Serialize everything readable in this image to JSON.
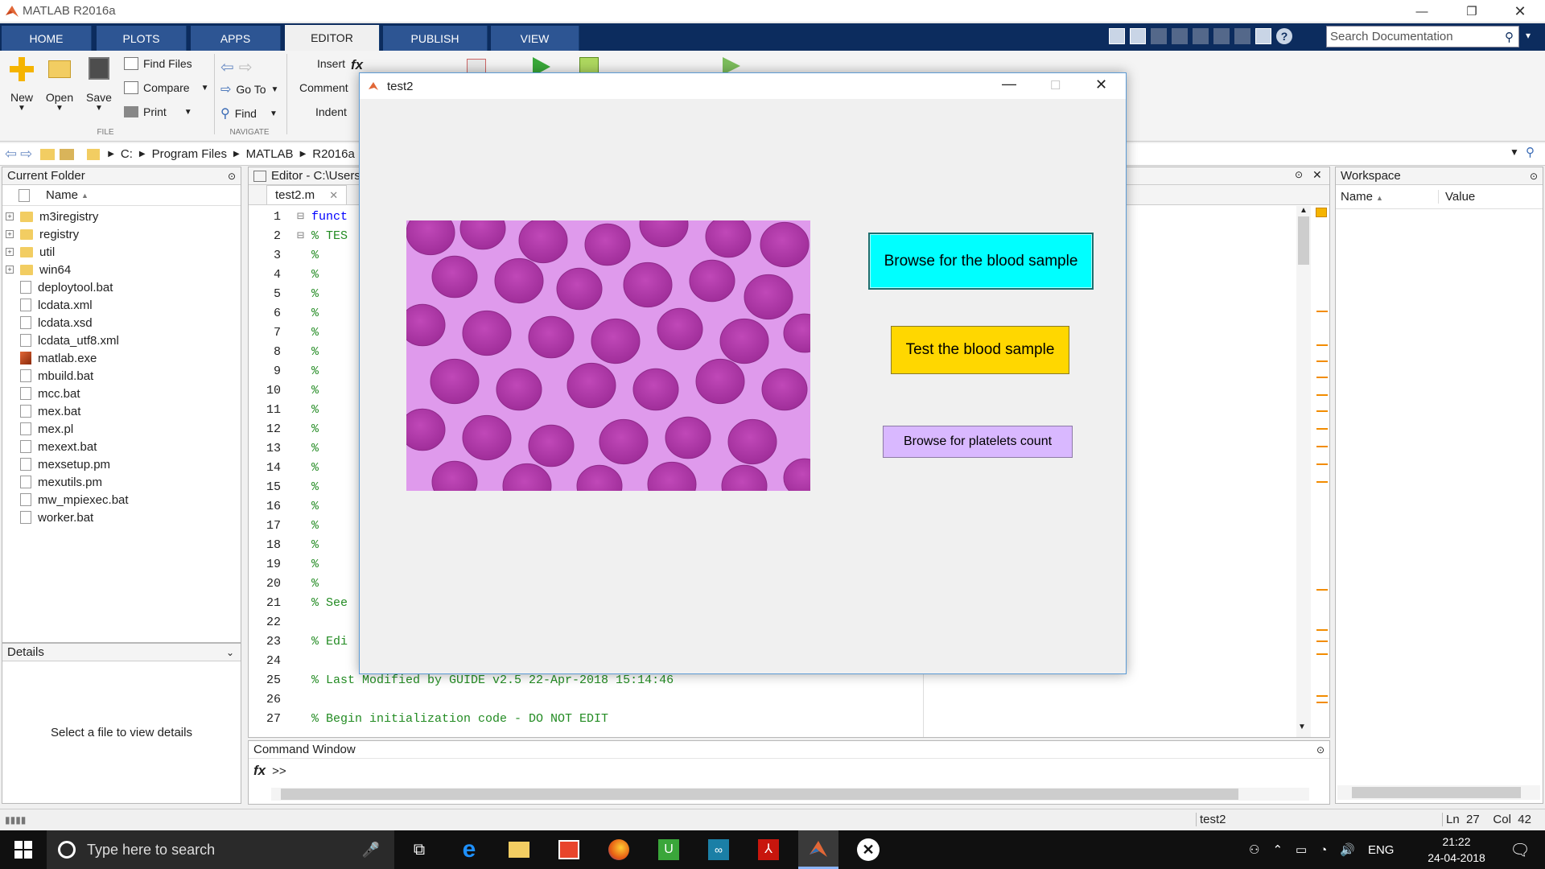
{
  "window": {
    "title": "MATLAB R2016a"
  },
  "tabs": [
    {
      "label": "HOME",
      "active": false
    },
    {
      "label": "PLOTS",
      "active": false
    },
    {
      "label": "APPS",
      "active": false
    },
    {
      "label": "EDITOR",
      "active": true
    },
    {
      "label": "PUBLISH",
      "active": false
    },
    {
      "label": "VIEW",
      "active": false
    }
  ],
  "search": {
    "placeholder": "Search Documentation"
  },
  "ribbon": {
    "new": "New",
    "open": "Open",
    "save": "Save",
    "find_files": "Find Files",
    "compare": "Compare",
    "print": "Print",
    "go_to": "Go To",
    "find": "Find",
    "insert": "Insert",
    "comment": "Comment",
    "indent": "Indent",
    "file_section": "FILE",
    "navigate_section": "NAVIGATE"
  },
  "address": {
    "crumbs": [
      "C:",
      "Program Files",
      "MATLAB",
      "R2016a"
    ]
  },
  "current_folder": {
    "title": "Current Folder",
    "column": "Name",
    "folders": [
      "m3iregistry",
      "registry",
      "util",
      "win64"
    ],
    "files": [
      "deploytool.bat",
      "lcdata.xml",
      "lcdata.xsd",
      "lcdata_utf8.xml",
      "matlab.exe",
      "mbuild.bat",
      "mcc.bat",
      "mex.bat",
      "mex.pl",
      "mexext.bat",
      "mexsetup.pm",
      "mexutils.pm",
      "mw_mpiexec.bat",
      "worker.bat"
    ]
  },
  "details": {
    "title": "Details",
    "message": "Select a file to view details"
  },
  "editor": {
    "title": "Editor - C:\\Users\\",
    "tab": "test2.m",
    "lines": [
      {
        "n": "1",
        "text": "funct",
        "type": "kw"
      },
      {
        "n": "2",
        "text": "% TES",
        "type": "cm"
      },
      {
        "n": "3",
        "text": "%",
        "type": "cm"
      },
      {
        "n": "4",
        "text": "%",
        "type": "cm"
      },
      {
        "n": "5",
        "text": "%",
        "type": "cm"
      },
      {
        "n": "6",
        "text": "%",
        "type": "cm"
      },
      {
        "n": "7",
        "text": "%",
        "type": "cm"
      },
      {
        "n": "8",
        "text": "%",
        "type": "cm"
      },
      {
        "n": "9",
        "text": "%",
        "type": "cm"
      },
      {
        "n": "10",
        "text": "%",
        "type": "cm"
      },
      {
        "n": "11",
        "text": "%",
        "type": "cm"
      },
      {
        "n": "12",
        "text": "%",
        "type": "cm"
      },
      {
        "n": "13",
        "text": "%",
        "type": "cm"
      },
      {
        "n": "14",
        "text": "%",
        "type": "cm"
      },
      {
        "n": "15",
        "text": "%",
        "type": "cm"
      },
      {
        "n": "16",
        "text": "%",
        "type": "cm"
      },
      {
        "n": "17",
        "text": "%",
        "type": "cm"
      },
      {
        "n": "18",
        "text": "%",
        "type": "cm"
      },
      {
        "n": "19",
        "text": "%",
        "type": "cm"
      },
      {
        "n": "20",
        "text": "%",
        "type": "cm"
      },
      {
        "n": "21",
        "text": "% See",
        "type": "cm"
      },
      {
        "n": "22",
        "text": "",
        "type": "cm"
      },
      {
        "n": "23",
        "text": "% Edi",
        "type": "cm"
      },
      {
        "n": "24",
        "text": "",
        "type": "cm"
      },
      {
        "n": "25",
        "text": "% Last Modified by GUIDE v2.5 22-Apr-2018 15:14:46",
        "type": "cm"
      },
      {
        "n": "26",
        "text": "",
        "type": "cm"
      },
      {
        "n": "27",
        "text": "% Begin initialization code - DO NOT EDIT",
        "type": "cm"
      }
    ]
  },
  "workspace": {
    "title": "Workspace",
    "col_name": "Name",
    "col_value": "Value"
  },
  "command_window": {
    "title": "Command Window",
    "prompt": ">>"
  },
  "status": {
    "file": "test2",
    "ln_label": "Ln",
    "ln": "27",
    "col_label": "Col",
    "col": "42"
  },
  "dialog": {
    "title": "test2",
    "browse_blood": "Browse for the blood sample",
    "test_blood": "Test the blood sample",
    "browse_platelets": "Browse for platelets count",
    "colors": {
      "browse": "#00ffff",
      "test": "#ffd700",
      "platelets": "#d9b8ff"
    }
  },
  "taskbar": {
    "search_placeholder": "Type here to search",
    "lang": "ENG",
    "time": "21:22",
    "date": "24-04-2018"
  }
}
